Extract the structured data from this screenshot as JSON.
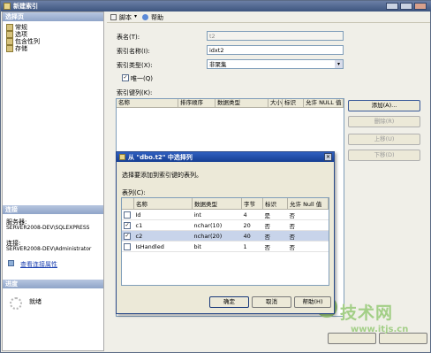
{
  "window": {
    "title": "新建索引"
  },
  "left": {
    "select_page_header": "选择页",
    "nav": [
      "常规",
      "选项",
      "包含性列",
      "存储"
    ],
    "connection_header": "连接",
    "server_label": "服务器:",
    "server_value": "SERVER2008-DEV\\SQLEXPRESS",
    "conn_label": "连接:",
    "conn_value": "SERVER2008-DEV\\Administrator",
    "conn_link": "查看连接属性",
    "progress_header": "进度",
    "progress_status": "就绪"
  },
  "toolbar": {
    "script": "脚本",
    "help": "帮助"
  },
  "form": {
    "table_label": "表名(T):",
    "table_value": "t2",
    "index_label": "索引名称(I):",
    "index_value": "idxt2",
    "type_label": "索引类型(X):",
    "type_value": "非聚集",
    "unique_label": "唯一(Q)",
    "keycols_label": "索引键列(K):"
  },
  "keycols_headers": [
    "名称",
    "排序顺序",
    "数据类型",
    "大小",
    "标识",
    "允许 NULL 值"
  ],
  "side_buttons": {
    "add": "添加(A)...",
    "remove": "删除(R)",
    "up": "上移(U)",
    "down": "下移(D)"
  },
  "dialog": {
    "title": "从 \"dbo.t2\" 中选择列",
    "instruction": "选择要添加到索引键的表列。",
    "table_label": "表列(C):",
    "headers": [
      "名称",
      "数据类型",
      "字节",
      "标识",
      "允许 Null 值"
    ],
    "rows": [
      {
        "checked": false,
        "name": "Id",
        "type": "int",
        "bytes": "4",
        "identity": "是",
        "nullable": "否"
      },
      {
        "checked": true,
        "name": "c1",
        "type": "nchar(10)",
        "bytes": "20",
        "identity": "否",
        "nullable": "否"
      },
      {
        "checked": true,
        "name": "c2",
        "type": "nchar(20)",
        "bytes": "40",
        "identity": "否",
        "nullable": "否"
      },
      {
        "checked": false,
        "name": "IsHandled",
        "type": "bit",
        "bytes": "1",
        "identity": "否",
        "nullable": "否"
      }
    ],
    "ok": "确定",
    "cancel": "取消",
    "help": "帮助(H)"
  },
  "watermark": {
    "big": "技术网",
    "url": "www.itjs.cn"
  },
  "colors": {
    "title_blue": "#3d557f",
    "dialog_blue": "#163e93"
  }
}
